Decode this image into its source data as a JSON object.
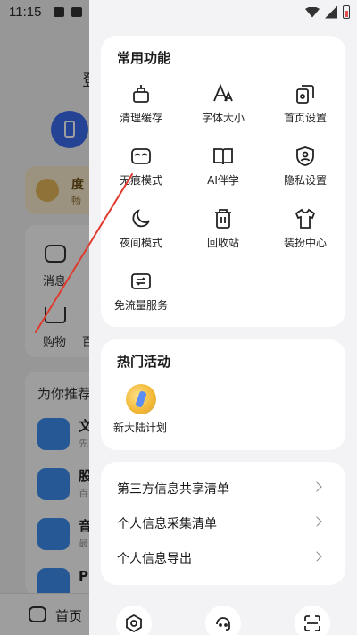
{
  "status": {
    "time": "11:15"
  },
  "background": {
    "login_text": "登",
    "vip_title": "度",
    "vip_subtitle": "畅",
    "messages_label": "消息",
    "cart_label": "购物",
    "cart_extra": "百",
    "recommend_title": "为你推荐",
    "apps": [
      {
        "title": "文",
        "subtitle": "先"
      },
      {
        "title": "股",
        "subtitle": "百"
      },
      {
        "title": "音",
        "subtitle": "最"
      },
      {
        "title": "PI",
        "subtitle": ""
      }
    ],
    "nav_home_label": "首页"
  },
  "common_functions": {
    "title": "常用功能",
    "items": [
      {
        "label": "清理缓存",
        "icon": "broom-icon"
      },
      {
        "label": "字体大小",
        "icon": "font-size-icon"
      },
      {
        "label": "首页设置",
        "icon": "homepage-settings-icon"
      },
      {
        "label": "无痕模式",
        "icon": "incognito-mask-icon"
      },
      {
        "label": "AI伴学",
        "icon": "book-icon"
      },
      {
        "label": "隐私设置",
        "icon": "privacy-shield-icon"
      },
      {
        "label": "夜间模式",
        "icon": "moon-icon"
      },
      {
        "label": "回收站",
        "icon": "trash-icon"
      },
      {
        "label": "装扮中心",
        "icon": "tshirt-icon"
      },
      {
        "label": "免流量服务",
        "icon": "data-free-icon"
      }
    ]
  },
  "hot_activities": {
    "title": "热门活动",
    "items": [
      {
        "label": "新大陆计划",
        "icon": "new-continent-icon"
      }
    ]
  },
  "info_list": [
    {
      "label": "第三方信息共享清单"
    },
    {
      "label": "个人信息采集清单"
    },
    {
      "label": "个人信息导出"
    }
  ],
  "bottom_buttons": [
    {
      "icon": "settings-hexagon-icon"
    },
    {
      "icon": "customer-service-icon"
    },
    {
      "icon": "scan-icon"
    }
  ],
  "colors": {
    "accent_blue": "#3d6cf0",
    "annotation_red": "#e03a2f"
  }
}
